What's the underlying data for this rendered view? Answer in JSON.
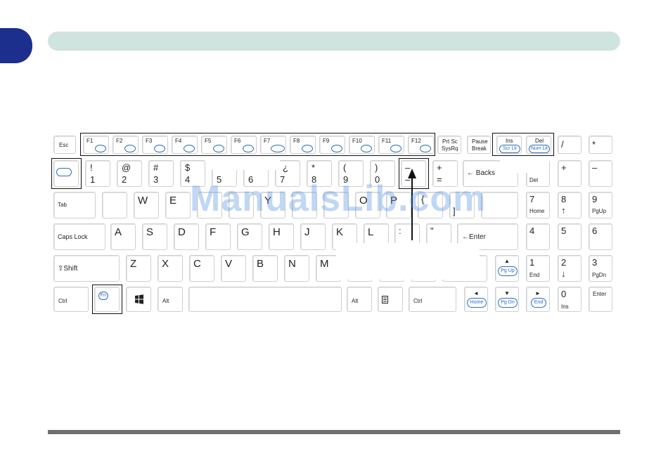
{
  "watermark": "ManualsLib.com",
  "keys": {
    "esc": "Esc",
    "f1": "F1",
    "f2": "F2",
    "f3": "F3",
    "f4": "F4",
    "f5": "F5",
    "f6": "F6",
    "f7": "F7",
    "f8": "F8",
    "f9": "F9",
    "f10": "F10",
    "f11": "F11",
    "f12": "F12",
    "prtsc_top": "Prt Sc",
    "prtsc_bottom": "SysRq",
    "pause_top": "Pause",
    "pause_bottom": "Break",
    "ins_top": "Ins",
    "ins_bottom": "Scr Lk",
    "del_top": "Del",
    "del_bottom": "Num Lk",
    "slash": "/",
    "star": "*",
    "excl": "!",
    "one": "1",
    "at": "@",
    "two": "2",
    "hash": "#",
    "three": "3",
    "dollar": "$",
    "four": "4",
    "five": "5",
    "six": "6",
    "seven": "7",
    "inv_q": "¿",
    "ast": "*",
    "eight": "8",
    "lparen": "(",
    "nine": "9",
    "rparen": ")",
    "zero": "0",
    "minus_top": "–",
    "minus_bottom": "–",
    "plus": "+",
    "equals": "=",
    "backspace": "← Backs",
    "num_plus": "+",
    "num_minus": "–",
    "del_num": "Del",
    "tab": "Tab",
    "w": "W",
    "e": "E",
    "y": "Y",
    "o": "O",
    "p": "P",
    "lbrace": "{",
    "rbracket": "]",
    "num7": "7",
    "home": "Home",
    "num8": "8",
    "num8_arrow": "↑",
    "num9": "9",
    "pgup": "PgUp",
    "caps": "Caps Lock",
    "a": "A",
    "s": "S",
    "d": "D",
    "f": "F",
    "g": "G",
    "h": "H",
    "j": "J",
    "k": "K",
    "l": "L",
    "colon": ":",
    "quote": "\"",
    "enter": "←Enter",
    "num4": "4",
    "num5": "5",
    "num6": "6",
    "shift": "⇧Shift",
    "z": "Z",
    "x": "X",
    "c": "C",
    "v": "V",
    "b": "B",
    "n": "N",
    "m": "M",
    "pgup_oval": "Pg Up",
    "num1": "1",
    "end": "End",
    "num2": "2",
    "num2_arrow": "↓",
    "num3": "3",
    "pgdn": "PgDn",
    "ctrl_l": "Ctrl",
    "fn": "Fn",
    "alt_l": "Alt",
    "alt_r": "Alt",
    "ctrl_r": "Ctrl",
    "home_oval": "Home",
    "pgdn_oval": "Pg Dn",
    "end_oval": "End",
    "num0": "0",
    "ins": "Ins",
    "num_enter": "Enter",
    "up_arrow": "▲",
    "left_arrow": "◄",
    "down_arrow": "▼",
    "right_arrow": "►"
  }
}
